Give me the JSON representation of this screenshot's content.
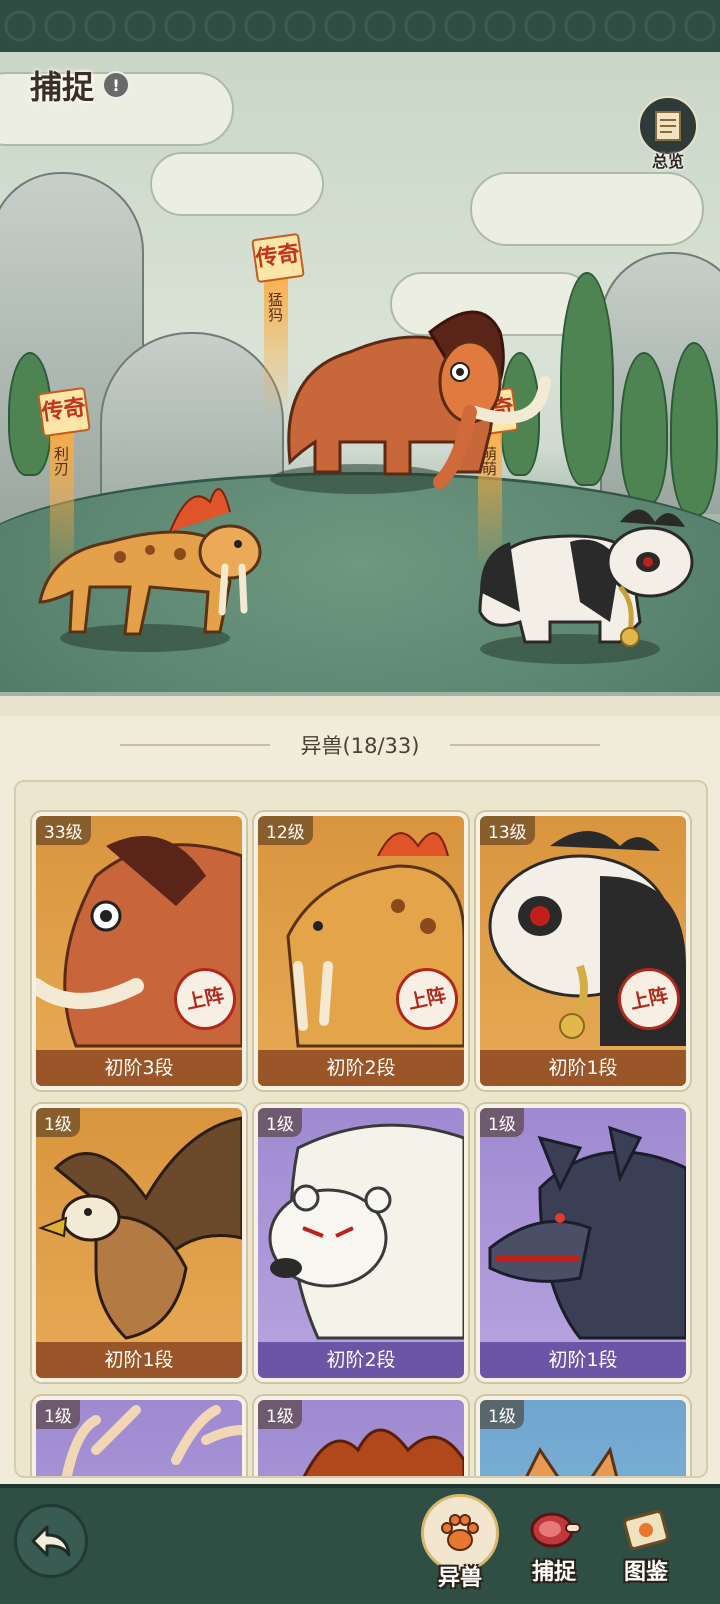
{
  "header": {
    "title": "捕捉",
    "info_glyph": "!",
    "overview_label": "总览"
  },
  "scene": {
    "creatures": [
      {
        "rarity": "传奇",
        "name": "利刃"
      },
      {
        "rarity": "传奇",
        "name": "猛犸"
      },
      {
        "rarity": "传奇",
        "name": "萌萌"
      }
    ]
  },
  "list": {
    "title": "异兽(18/33)",
    "cards": [
      {
        "level": "33级",
        "stage": "初阶3段",
        "deploy": "上阵",
        "theme": "orange",
        "icon": "mammoth"
      },
      {
        "level": "12级",
        "stage": "初阶2段",
        "deploy": "上阵",
        "theme": "orange",
        "icon": "sabertooth"
      },
      {
        "level": "13级",
        "stage": "初阶1段",
        "deploy": "上阵",
        "theme": "orange",
        "icon": "panda"
      },
      {
        "level": "1级",
        "stage": "初阶1段",
        "theme": "orange",
        "icon": "eagle"
      },
      {
        "level": "1级",
        "stage": "初阶2段",
        "theme": "purple",
        "icon": "polar-bear"
      },
      {
        "level": "1级",
        "stage": "初阶1段",
        "theme": "purple",
        "icon": "wolf"
      },
      {
        "level": "1级",
        "theme": "purple",
        "icon": "deer"
      },
      {
        "level": "1级",
        "theme": "purple",
        "icon": "fire-beast"
      },
      {
        "level": "1级",
        "theme": "blue",
        "icon": "tiger-cat"
      }
    ]
  },
  "bottom_nav": {
    "back_icon": "back-arrow-icon",
    "items": [
      {
        "label": "异兽",
        "icon": "paw-icon",
        "active": true
      },
      {
        "label": "捕捉",
        "icon": "meat-icon",
        "active": false
      },
      {
        "label": "图鉴",
        "icon": "scroll-icon",
        "active": false
      }
    ]
  }
}
